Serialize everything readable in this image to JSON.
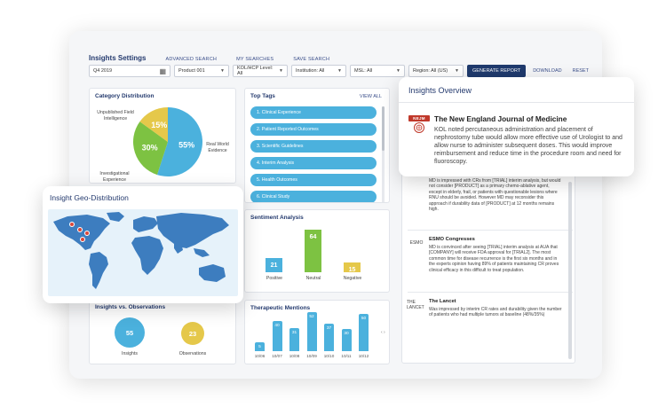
{
  "nav": {
    "title": "Insights Settings",
    "advanced_search": "ADVANCED SEARCH",
    "my_searches": "MY SEARCHES",
    "save_search": "SAVE SEARCH"
  },
  "filters": {
    "date": "Q4 2019",
    "product": "Product 001",
    "kol_level": "KOL/HCP Level: All",
    "institution": "Institution: All",
    "msl": "MSL: All",
    "region": "Region: All (US)",
    "generate": "GENERATE REPORT",
    "download": "DOWNLOAD",
    "reset": "RESET"
  },
  "category": {
    "title": "Category Distribution",
    "labels": {
      "unpublished": "Unpublished Field Intelligence",
      "real_world": "Real World Evidence",
      "investigational": "Investigational Experience"
    }
  },
  "chart_data": [
    {
      "type": "pie",
      "title": "Category Distribution",
      "categories": [
        "Real World Evidence",
        "Unpublished Field Intelligence",
        "Investigational Experience"
      ],
      "values": [
        55,
        30,
        15
      ],
      "labels": [
        "55%",
        "30%",
        "15%"
      ],
      "colors": [
        "#4bb1dd",
        "#7dc242",
        "#e5c84a"
      ]
    },
    {
      "type": "bar",
      "title": "Sentiment Analysis",
      "categories": [
        "Positive",
        "Neutral",
        "Negative"
      ],
      "values": [
        21,
        64,
        15
      ],
      "colors": [
        "#4bb1dd",
        "#7dc242",
        "#e5c84a"
      ]
    },
    {
      "type": "bar",
      "title": "Therapeutic Mentions",
      "categories": [
        "10/06",
        "10/07",
        "10/08",
        "10/09",
        "10/10",
        "10/11",
        "10/12"
      ],
      "values": [
        5,
        40,
        31,
        52,
        37,
        30,
        50
      ]
    }
  ],
  "tags": {
    "title": "Top Tags",
    "view_all": "VIEW ALL",
    "items": [
      "1. Clinical Experience",
      "2. Patient Reported Outcomes",
      "3. Scientific Guidelines",
      "4. Interim Analysis",
      "5. Health Outcomes",
      "6. Clinical Study"
    ]
  },
  "sentiment": {
    "title": "Sentiment Analysis",
    "labels": [
      "Positive",
      "Neutral",
      "Negative"
    ]
  },
  "therapeutic": {
    "title": "Therapeutic Mentions",
    "more": "‹ ›"
  },
  "insights_obs": {
    "title": "Insights vs. Observations",
    "insights_value": "55",
    "insights_label": "Insights",
    "observations_value": "23",
    "observations_label": "Observations"
  },
  "geo": {
    "title": "Insight  Geo-Distribution"
  },
  "overview": {
    "title": "Insights Overview",
    "logo": "NEJM",
    "source": "The New England Journal of Medicine",
    "text": "KOL noted percutaneous administration and placement of nephrostomy tube would allow more effective use of Urologist to and allow nurse to administer subsequent doses. This would improve reimbursement and reduce time in the procedure room and need for fluoroscopy."
  },
  "feed": {
    "items": [
      {
        "source": "",
        "logo": "",
        "text": "MD is impressed with CRs from [TRIAL] interim analysis, but would not consider [PRODUCT] as a primary chemo-ablative agent, except in elderly, frail, or patients with questionable lesions where RNU should be avoided. However MD may reconsider this approach if durability data of [PRODUCT] at 12 months remains high."
      },
      {
        "source": "ESMO Congresses",
        "logo": "ESMO",
        "text": "MD is convinced after seeing [TRIAL] interim analysis at AUA that [COMPANY] will receive FDA approval for [TRIAL2]. The most common time for disease recurrence is the first six months and in the experts opinion having 89% of patients maintaining CR proves clinical efficacy in this difficult to treat population."
      },
      {
        "source": "The Lancet",
        "logo": "THE LANCET",
        "text": "Was impressed by interim CR rates and durability given the number of patients who had multiple tumors at baseline (48%/35%)"
      }
    ]
  },
  "colors": {
    "navy": "#1f3a6d",
    "blue": "#4bb1dd",
    "green": "#7dc242",
    "yellow": "#e5c84a",
    "marker": "#d9473a"
  }
}
